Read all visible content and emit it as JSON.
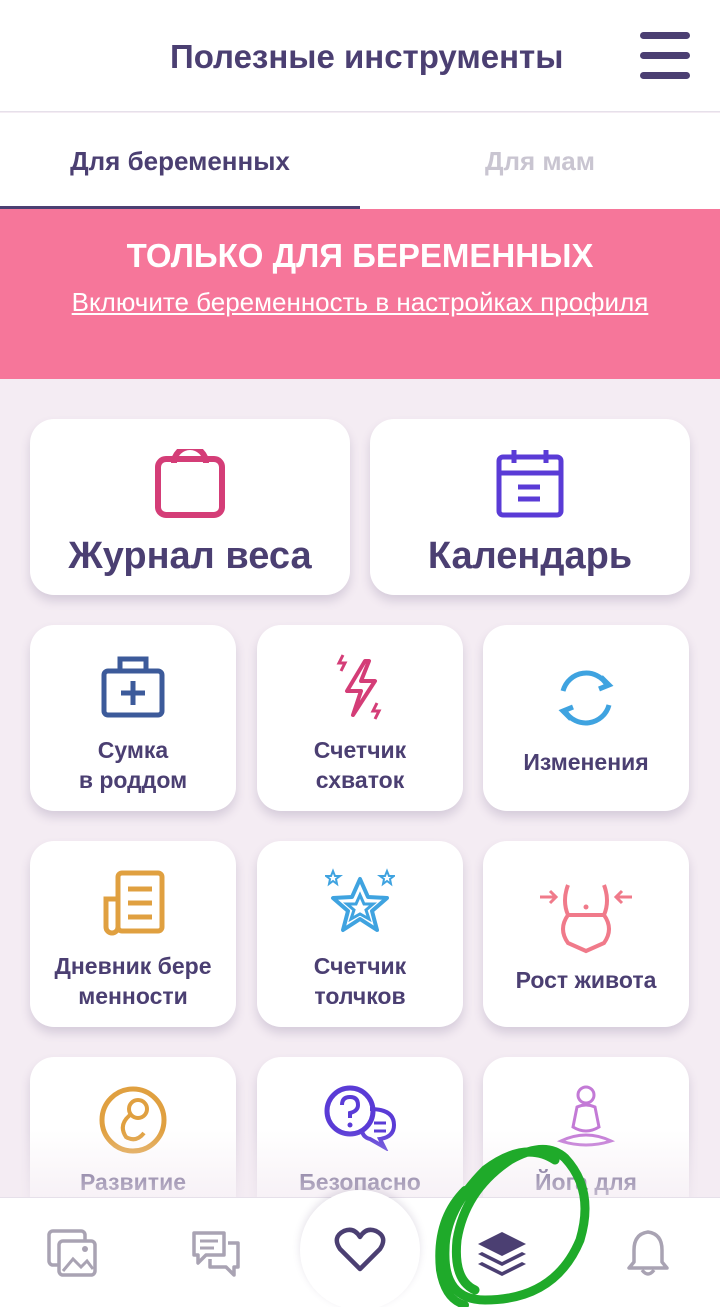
{
  "header": {
    "title": "Полезные инструменты",
    "menu_icon": "hamburger-menu-icon"
  },
  "tabs": [
    {
      "label": "Для беременных",
      "active": true
    },
    {
      "label": "Для мам",
      "active": false
    }
  ],
  "banner": {
    "title": "ТОЛЬКО ДЛЯ БЕРЕМЕННЫХ",
    "link": "Включите беременность в настройках профиля",
    "color": "#f6769a"
  },
  "tools": {
    "weight": {
      "label": "Журнал веса",
      "icon": "scale-icon",
      "color": "#d43d77"
    },
    "calendar": {
      "label": "Календарь",
      "icon": "calendar-icon",
      "color": "#5a3bd6"
    },
    "bag": {
      "line1": "Сумка",
      "line2": "в роддом",
      "icon": "medical-bag-icon",
      "color": "#3c5a9a"
    },
    "contractions": {
      "line1": "Счетчик",
      "line2": "схваток",
      "icon": "lightning-icon",
      "color": "#d43d77"
    },
    "changes": {
      "label": "Изменения",
      "icon": "refresh-cycle-icon",
      "color": "#3fa3e0"
    },
    "diary": {
      "line1": "Дневник бере",
      "line2": "менности",
      "icon": "diary-icon",
      "color": "#e0a040"
    },
    "kicks": {
      "line1": "Счетчик",
      "line2": "толчков",
      "icon": "star-icon",
      "color": "#3fa3e0"
    },
    "belly": {
      "label": "Рост живота",
      "icon": "belly-growth-icon",
      "color": "#f07a8a"
    },
    "development": {
      "label": "Развитие",
      "icon": "fetus-icon",
      "color": "#e0a040"
    },
    "safety": {
      "label": "Безопасно",
      "icon": "question-chat-icon",
      "color": "#5a3bd6"
    },
    "yoga": {
      "label": "Йога для",
      "icon": "yoga-icon",
      "color": "#c37ad6"
    }
  },
  "bottom_nav": [
    {
      "icon": "gallery-icon"
    },
    {
      "icon": "chat-icon"
    },
    {
      "icon": "heart-icon"
    },
    {
      "icon": "layers-icon",
      "active": true
    },
    {
      "icon": "bell-icon"
    }
  ],
  "colors": {
    "primary": "#4b3f72",
    "background": "#f4ecf3",
    "annotation": "#1faa2a"
  }
}
